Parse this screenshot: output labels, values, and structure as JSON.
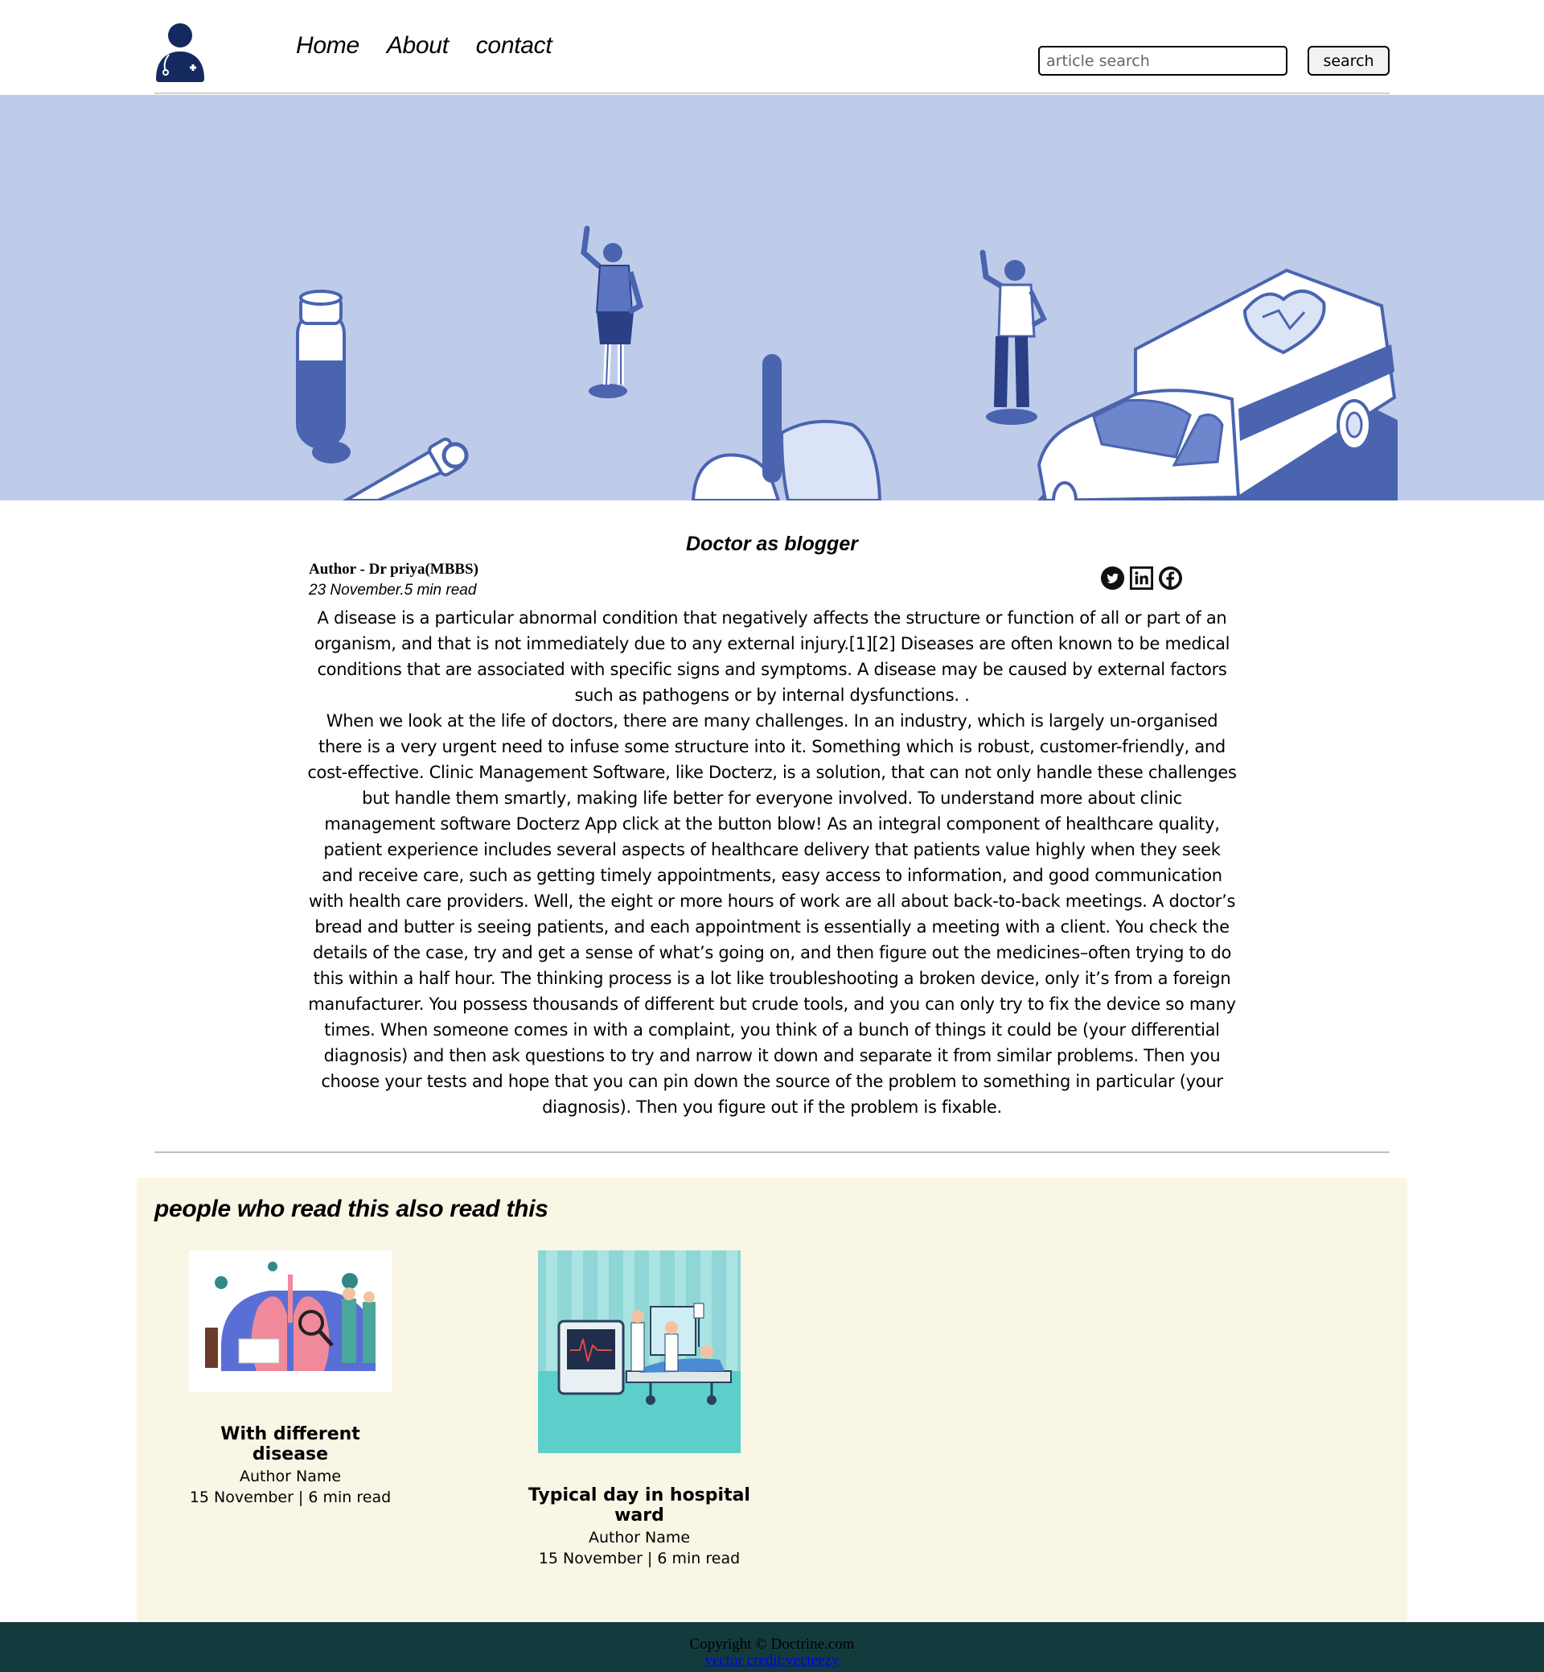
{
  "nav": {
    "items": [
      {
        "label": "Home"
      },
      {
        "label": "About"
      },
      {
        "label": "contact"
      }
    ]
  },
  "search": {
    "placeholder": "article search",
    "button_label": "search"
  },
  "icons": {
    "logo": "doctor-logo-icon",
    "social": [
      "twitter-icon",
      "linkedin-icon",
      "facebook-icon"
    ]
  },
  "colors": {
    "hero_bg": "#bfcce9",
    "illustration_blue": "#4a64b0",
    "related_bg": "#f9f6e6",
    "footer_bg": "#133b3e",
    "logo_navy": "#14295e"
  },
  "article": {
    "title": "Doctor as blogger",
    "author": "Author - Dr priya(MBBS)",
    "date": "23 November.5 min read",
    "paragraphs": [
      "A disease is a particular abnormal condition that negatively affects the structure or function of all or part of an organism, and that is not immediately due to any external injury.[1][2] Diseases are often known to be medical conditions that are associated with specific signs and symptoms. A disease may be caused by external factors such as pathogens or by internal dysfunctions. .",
      "When we look at the life of doctors, there are many challenges. In an industry, which is largely un-organised there is a very urgent need to infuse some structure into it. Something which is robust, customer-friendly, and cost-effective. Clinic Management Software, like Docterz, is a solution, that can not only handle these challenges but handle them smartly, making life better for everyone involved. To understand more about clinic management software Docterz App click at the button blow! As an integral component of healthcare quality, patient experience includes several aspects of healthcare delivery that patients value highly when they seek and receive care, such as getting timely appointments, easy access to information, and good communication with health care providers. Well, the eight or more hours of work are all about back-to-back meetings. A doctor’s bread and butter is seeing patients, and each appointment is essentially a meeting with a client. You check the details of the case, try and get a sense of what’s going on, and then figure out the medicines–often trying to do this within a half hour. The thinking process is a lot like troubleshooting a broken device, only it’s from a foreign manufacturer. You possess thousands of different but crude tools, and you can only try to fix the device so many times. When someone comes in with a complaint, you think of a bunch of things it could be (your differential diagnosis) and then ask questions to try and narrow it down and separate it from similar problems. Then you choose your tests and hope that you can pin down the source of the problem to something in particular (your diagnosis). Then you figure out if the problem is fixable."
    ]
  },
  "related": {
    "heading": "people who read this also read this",
    "cards": [
      {
        "title": "With different disease",
        "author": "Author Name",
        "date": "15 November | 6 min read"
      },
      {
        "title": "Typical day in hospital ward",
        "author": "Author Name",
        "date": "15 November | 6 min read"
      }
    ]
  },
  "footer": {
    "copyright": "Copyright © Doctrine.com",
    "credit": "vector credit:vecteezy"
  }
}
